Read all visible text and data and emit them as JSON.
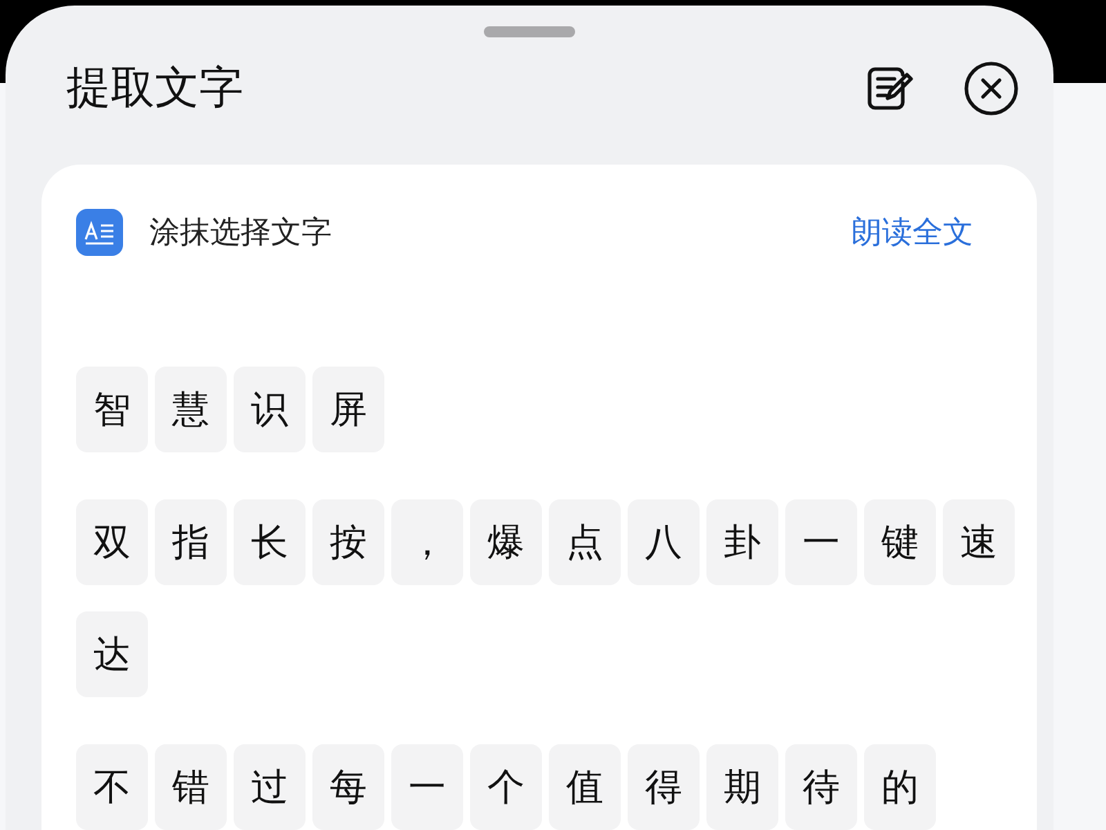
{
  "sheet": {
    "title": "提取文字"
  },
  "card": {
    "mode_label": "涂抹选择文字",
    "read_all": "朗读全文",
    "paragraphs": [
      {
        "chars": [
          "智",
          "慧",
          "识",
          "屏"
        ]
      },
      {
        "chars": [
          "双",
          "指",
          "长",
          "按",
          "，",
          "爆",
          "点",
          "八",
          "卦",
          "一",
          "键",
          "速",
          "达"
        ]
      },
      {
        "chars": [
          "不",
          "错",
          "过",
          "每",
          "一",
          "个",
          "值",
          "得",
          "期",
          "待",
          "的"
        ]
      }
    ]
  }
}
